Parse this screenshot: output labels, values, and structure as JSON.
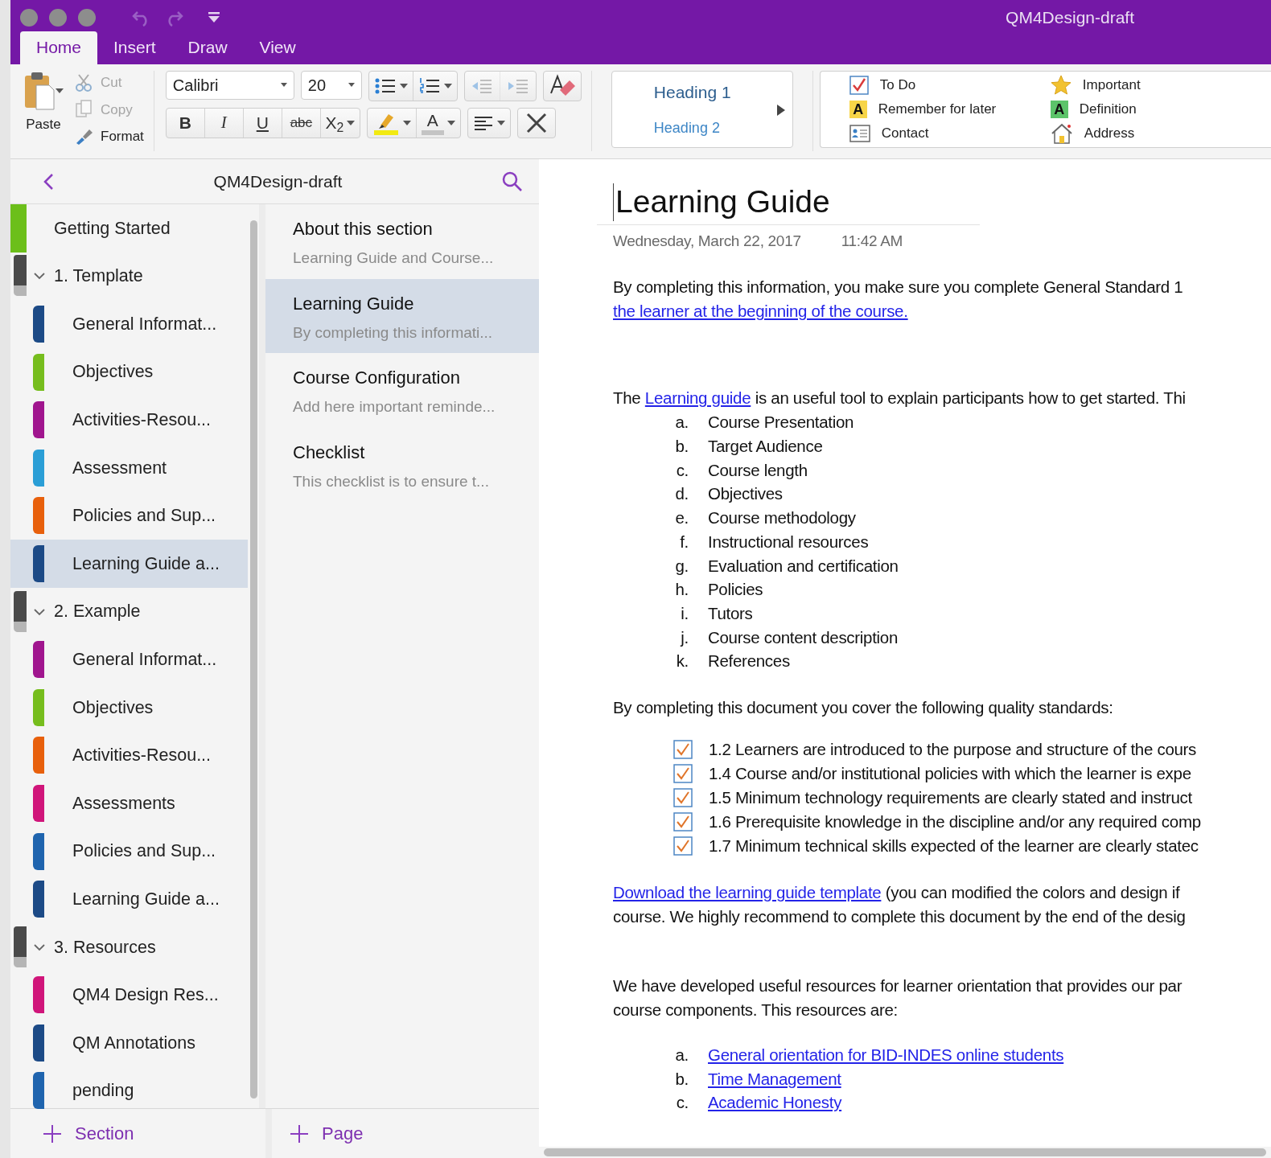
{
  "window": {
    "title": "QM4Design-draft"
  },
  "ribbon_tabs": [
    {
      "label": "Home",
      "selected": true
    },
    {
      "label": "Insert",
      "selected": false
    },
    {
      "label": "Draw",
      "selected": false
    },
    {
      "label": "View",
      "selected": false
    }
  ],
  "clipboard": {
    "paste": "Paste",
    "cut": {
      "label": "Cut",
      "disabled": true
    },
    "copy": {
      "label": "Copy",
      "disabled": true
    },
    "format": {
      "label": "Format",
      "disabled": false
    }
  },
  "font": {
    "name": "Calibri",
    "size": "20"
  },
  "list_buttons": [
    {
      "kind": "bullets",
      "disabled": false
    },
    {
      "kind": "numbering",
      "disabled": false
    },
    {
      "kind": "outdent",
      "disabled": true
    },
    {
      "kind": "indent",
      "disabled": true
    }
  ],
  "format_buttons": [
    {
      "kind": "bold",
      "label": "B"
    },
    {
      "kind": "italic",
      "label": "I"
    },
    {
      "kind": "underline",
      "label": "U"
    },
    {
      "kind": "strike",
      "label": "abc"
    },
    {
      "kind": "subscript",
      "label": "X$_{2}$"
    }
  ],
  "font_color": {
    "label": "A"
  },
  "styles": [
    "Heading 1",
    "Heading 2"
  ],
  "tags": [
    {
      "kind": "todo",
      "label": "To Do"
    },
    {
      "kind": "important",
      "label": "Important"
    },
    {
      "kind": "remember",
      "glyph": "A",
      "label": "Remember for later"
    },
    {
      "kind": "definition",
      "glyph": "A",
      "label": "Definition"
    },
    {
      "kind": "contact",
      "label": "Contact"
    },
    {
      "kind": "address",
      "label": "Address"
    }
  ],
  "notebook": {
    "title": "QM4Design-draft"
  },
  "sections": [
    {
      "kind": "section",
      "label": "Getting Started",
      "color": "#6cbf1a",
      "selected": false
    },
    {
      "kind": "group",
      "label": "1. Template",
      "expanded": true,
      "children": [
        {
          "kind": "section",
          "label": "General Informat...",
          "color": "#1c4a86",
          "selected": false
        },
        {
          "kind": "section",
          "label": "Objectives",
          "color": "#76bd1d",
          "selected": false
        },
        {
          "kind": "section",
          "label": "Activities-Resou...",
          "color": "#a0158e",
          "selected": false
        },
        {
          "kind": "section",
          "label": "Assessment",
          "color": "#2a9ed6",
          "selected": false
        },
        {
          "kind": "section",
          "label": "Policies and Sup...",
          "color": "#e8600c",
          "selected": false
        },
        {
          "kind": "section",
          "label": "Learning Guide a...",
          "color": "#1c4a86",
          "selected": true
        }
      ]
    },
    {
      "kind": "group",
      "label": "2. Example",
      "expanded": true,
      "children": [
        {
          "kind": "section",
          "label": "General Informat...",
          "color": "#a0158e",
          "selected": false
        },
        {
          "kind": "section",
          "label": "Objectives",
          "color": "#76bd1d",
          "selected": false
        },
        {
          "kind": "section",
          "label": "Activities-Resou...",
          "color": "#e8600c",
          "selected": false
        },
        {
          "kind": "section",
          "label": "Assessments",
          "color": "#d0157a",
          "selected": false
        },
        {
          "kind": "section",
          "label": "Policies and Sup...",
          "color": "#1f64ae",
          "selected": false
        },
        {
          "kind": "section",
          "label": "Learning Guide a...",
          "color": "#1c4a86",
          "selected": false
        }
      ]
    },
    {
      "kind": "group",
      "label": "3. Resources",
      "expanded": true,
      "children": [
        {
          "kind": "section",
          "label": "QM4 Design Res...",
          "color": "#d0157a",
          "selected": false
        },
        {
          "kind": "section",
          "label": "QM Annotations",
          "color": "#1c4a86",
          "selected": false
        },
        {
          "kind": "section",
          "label": "pending",
          "color": "#1f64ae",
          "selected": false
        }
      ]
    }
  ],
  "pages": [
    {
      "title": "About this section",
      "preview": "Learning Guide and Course...",
      "selected": false
    },
    {
      "title": "Learning Guide",
      "preview": "By completing this informati...",
      "selected": true
    },
    {
      "title": "Course Configuration",
      "preview": "Add here important reminde...",
      "selected": false
    },
    {
      "title": "Checklist",
      "preview": "This checklist is to ensure t...",
      "selected": false
    }
  ],
  "add_section": "Section",
  "add_page": "Page",
  "page": {
    "title": "Learning Guide",
    "date": "Wednesday,  March 22, 2017",
    "time": "11:42 AM",
    "blocks": [
      {
        "kind": "paragraph",
        "lines": [
          [
            {
              "text": "By completing this information, you make sure you complete General Standard 1"
            }
          ],
          [
            {
              "link": "the learner at the beginning of the course."
            }
          ]
        ]
      },
      {
        "kind": "paragraph",
        "lines": [
          [
            {
              "text": "The "
            },
            {
              "link": "Learning guide"
            },
            {
              "text": " is an useful tool to explain  participants how to get started.  Thi"
            }
          ]
        ]
      },
      {
        "kind": "list",
        "items": [
          {
            "marker": "a.",
            "text": "Course Presentation"
          },
          {
            "marker": "b.",
            "text": "Target Audience"
          },
          {
            "marker": "c.",
            "text": "Course length"
          },
          {
            "marker": "d.",
            "text": "Objectives"
          },
          {
            "marker": "e.",
            "text": "Course methodology"
          },
          {
            "marker": "f.",
            "text": "Instructional resources"
          },
          {
            "marker": "g.",
            "text": "Evaluation and certification"
          },
          {
            "marker": "h.",
            "text": "Policies"
          },
          {
            "marker": "i.",
            "text": "Tutors"
          },
          {
            "marker": "j.",
            "text": "Course content description"
          },
          {
            "marker": "k.",
            "text": "References"
          }
        ]
      },
      {
        "kind": "paragraph",
        "lines": [
          [
            {
              "text": "By completing this document you cover the following quality standards:"
            }
          ]
        ]
      },
      {
        "kind": "checklist",
        "items": [
          {
            "text": "1.2 Learners are introduced to the purpose and structure of the cours",
            "checked": true
          },
          {
            "text": "1.4 Course and/or institutional policies with which the learner is expe",
            "checked": true
          },
          {
            "text": "1.5 Minimum technology requirements are clearly stated and instruct",
            "checked": true
          },
          {
            "text": "1.6 Prerequisite knowledge in the discipline and/or any required comp",
            "checked": true
          },
          {
            "text": "1.7 Minimum technical skills expected of the learner are clearly statec",
            "checked": true
          }
        ]
      },
      {
        "kind": "paragraph",
        "lines": [
          [
            {
              "link": "Download the learning guide template"
            },
            {
              "text": " (you can modified the colors and design if"
            }
          ],
          [
            {
              "text": "course. We highly recommend to complete this document by the end of the desig"
            }
          ]
        ]
      },
      {
        "kind": "paragraph",
        "lines": [
          [
            {
              "text": "We have developed useful resources for learner orientation that provides our par"
            }
          ],
          [
            {
              "text": "course components.  This resources are:"
            }
          ]
        ]
      },
      {
        "kind": "linklist",
        "items": [
          {
            "marker": "a.",
            "link": "General orientation for BID-INDES online students"
          },
          {
            "marker": "b.",
            "link": "Time Management"
          },
          {
            "marker": "c.",
            "link": "Academic Honesty"
          }
        ]
      }
    ]
  }
}
